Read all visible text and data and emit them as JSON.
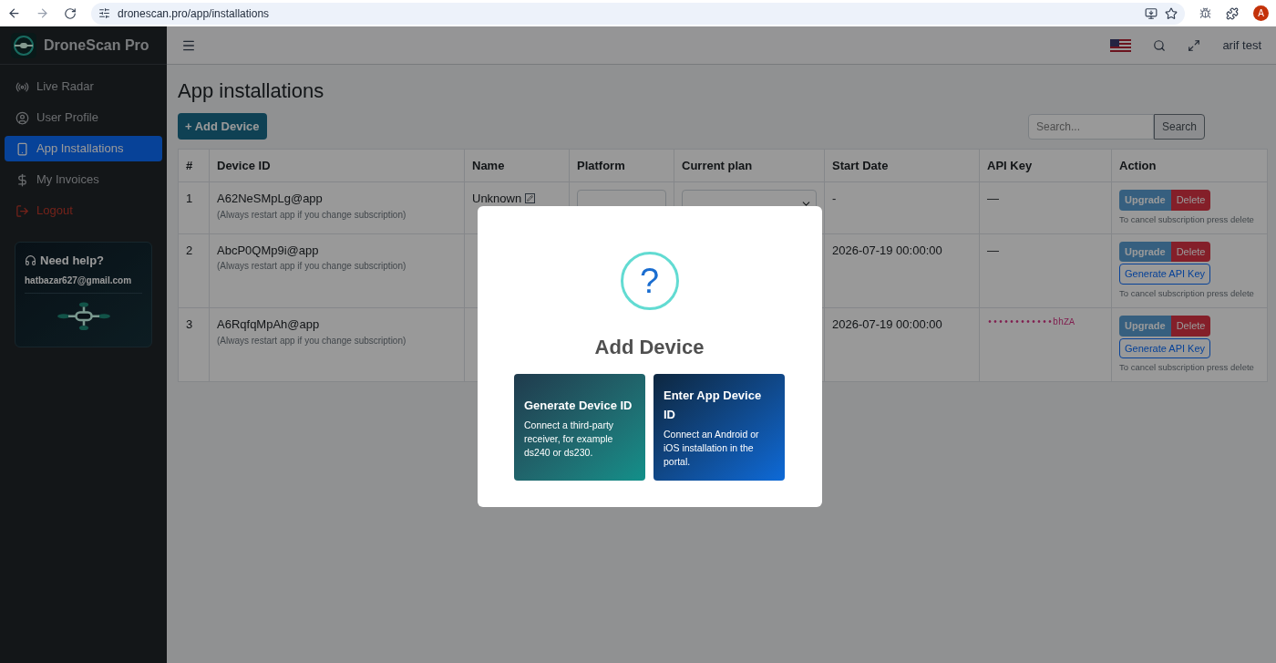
{
  "browser": {
    "url": "dronescan.pro/app/installations",
    "profile_initial": "A"
  },
  "sidebar": {
    "brand": "DroneScan Pro",
    "items": [
      {
        "label": "Live Radar",
        "selected": false,
        "kind": "nav"
      },
      {
        "label": "User Profile",
        "selected": false,
        "kind": "nav"
      },
      {
        "label": "App Installations",
        "selected": true,
        "kind": "nav"
      },
      {
        "label": "My Invoices",
        "selected": false,
        "kind": "nav"
      },
      {
        "label": "Logout",
        "selected": false,
        "kind": "danger"
      }
    ],
    "help": {
      "title": "Need help?",
      "email": "hatbazar627@gmail.com"
    }
  },
  "topbar": {
    "user": "arif test"
  },
  "page": {
    "title": "App installations",
    "add_button": "+ Add Device",
    "search": {
      "placeholder": "Search...",
      "button": "Search"
    }
  },
  "table": {
    "columns": [
      "#",
      "Device ID",
      "Name",
      "Platform",
      "Current plan",
      "Start Date",
      "API Key",
      "Action"
    ],
    "rows": [
      {
        "index": "1",
        "device_id": "A62NeSMpLg@app",
        "note": "(Always restart app if you change subscription)",
        "name": "Unknown",
        "start_date": "-",
        "api_key": {
          "text": "—",
          "kind": "empty"
        },
        "upgrade": "Upgrade",
        "delete": "Delete",
        "hint": "To cancel subscription press delete"
      },
      {
        "index": "2",
        "device_id": "AbcP0QMp9i@app",
        "note": "(Always restart app if you change subscription)",
        "start_date": "2026-07-19 00:00:00",
        "api_key": {
          "text": "—",
          "kind": "empty"
        },
        "upgrade": "Upgrade",
        "delete": "Delete",
        "generate": "Generate API Key",
        "hint": "To cancel subscription press delete"
      },
      {
        "index": "3",
        "device_id": "A6RqfqMpAh@app",
        "note": "(Always restart app if you change subscription)",
        "start_date": "2026-07-19 00:00:00",
        "api_key": {
          "text": "••••••••••••bhZA",
          "kind": "masked"
        },
        "upgrade": "Upgrade",
        "delete": "Delete",
        "generate": "Generate API Key",
        "hint": "To cancel subscription press delete"
      }
    ]
  },
  "modal": {
    "icon_text": "?",
    "title": "Add Device",
    "options": [
      {
        "title": "Generate Device ID",
        "text": "Connect a third-party receiver, for example ds240 or ds230.",
        "kind": "teal"
      },
      {
        "title": "Enter App Device ID",
        "text": "Connect an Android or iOS installation in the portal.",
        "kind": "blue"
      }
    ]
  }
}
